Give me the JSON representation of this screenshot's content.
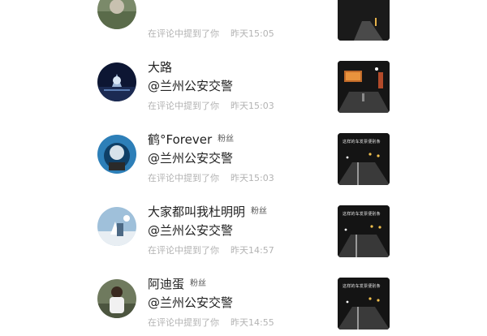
{
  "notifications": [
    {
      "name": "",
      "badge": "",
      "mention": "",
      "action": "在评论中提到了你",
      "time": "昨天15:05",
      "thumb_caption": "",
      "avatar_icon": "user-avatar-icon",
      "thumb_icon": "video-thumbnail-icon"
    },
    {
      "name": "大路",
      "badge": "",
      "mention": "@兰州公安交警",
      "action": "在评论中提到了你",
      "time": "昨天15:03",
      "thumb_caption": "",
      "avatar_icon": "user-avatar-icon",
      "thumb_icon": "video-thumbnail-icon"
    },
    {
      "name": "鹤°Forever",
      "badge": "粉丝",
      "mention": "@兰州公安交警",
      "action": "在评论中提到了你",
      "time": "昨天15:03",
      "thumb_caption": "这样的车发票便别条",
      "avatar_icon": "user-avatar-icon",
      "thumb_icon": "video-thumbnail-icon"
    },
    {
      "name": "大家都叫我杜明明",
      "badge": "粉丝",
      "mention": "@兰州公安交警",
      "action": "在评论中提到了你",
      "time": "昨天14:57",
      "thumb_caption": "这样的车发票便别条",
      "avatar_icon": "user-avatar-icon",
      "thumb_icon": "video-thumbnail-icon"
    },
    {
      "name": "阿迪蛋",
      "badge": "粉丝",
      "mention": "@兰州公安交警",
      "action": "在评论中提到了你",
      "time": "昨天14:55",
      "thumb_caption": "这样的车发票便别条",
      "avatar_icon": "user-avatar-icon",
      "thumb_icon": "video-thumbnail-icon"
    }
  ]
}
